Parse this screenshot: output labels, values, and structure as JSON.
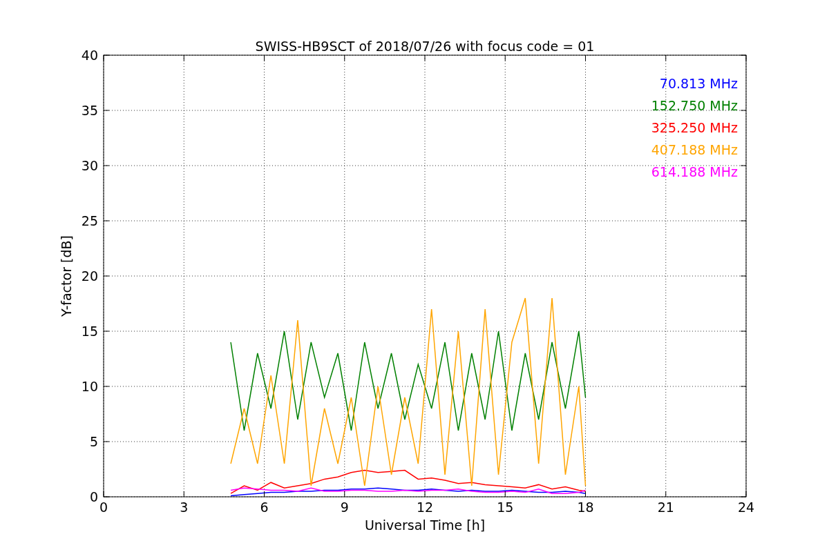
{
  "chart_data": {
    "type": "line",
    "title": "SWISS-HB9SCT of 2018/07/26 with focus code = 01",
    "xlabel": "Universal Time [h]",
    "ylabel": "Y-factor [dB]",
    "xlim": [
      0,
      24
    ],
    "ylim": [
      0,
      40
    ],
    "xticks": [
      0,
      3,
      6,
      9,
      12,
      15,
      18,
      21,
      24
    ],
    "yticks": [
      0,
      5,
      10,
      15,
      20,
      25,
      30,
      35,
      40
    ],
    "grid": true,
    "x": [
      4.75,
      5.25,
      5.75,
      6.25,
      6.75,
      7.25,
      7.75,
      8.25,
      8.75,
      9.25,
      9.75,
      10.25,
      10.75,
      11.25,
      11.75,
      12.25,
      12.75,
      13.25,
      13.75,
      14.25,
      14.75,
      15.25,
      15.75,
      16.25,
      16.75,
      17.25,
      17.75,
      18
    ],
    "series": [
      {
        "name": "70.813 MHz",
        "color": "#0000ff",
        "values": [
          0.1,
          0.2,
          0.3,
          0.4,
          0.4,
          0.5,
          0.5,
          0.6,
          0.6,
          0.7,
          0.7,
          0.8,
          0.7,
          0.6,
          0.6,
          0.7,
          0.6,
          0.5,
          0.6,
          0.5,
          0.5,
          0.6,
          0.5,
          0.4,
          0.4,
          0.5,
          0.4,
          0.3
        ]
      },
      {
        "name": "152.750 MHz",
        "color": "#008000",
        "values": [
          14,
          6,
          13,
          8,
          15,
          7,
          14,
          9,
          13,
          6,
          14,
          8,
          13,
          7,
          12,
          8,
          14,
          6,
          13,
          7,
          15,
          6,
          13,
          7,
          14,
          8,
          15,
          9
        ]
      },
      {
        "name": "325.250 MHz",
        "color": "#ff0000",
        "values": [
          0.3,
          1,
          0.6,
          1.3,
          0.8,
          1,
          1.2,
          1.6,
          1.8,
          2.2,
          2.4,
          2.2,
          2.3,
          2.4,
          1.6,
          1.7,
          1.5,
          1.2,
          1.3,
          1.1,
          1,
          0.9,
          0.8,
          1.1,
          0.7,
          0.9,
          0.6,
          0.5
        ]
      },
      {
        "name": "407.188 MHz",
        "color": "#ffa500",
        "values": [
          3,
          8,
          3,
          11,
          3,
          16,
          1,
          8,
          3,
          9,
          1,
          10,
          2,
          9,
          3,
          17,
          2,
          15,
          1,
          17,
          2,
          14,
          18,
          3,
          18,
          2,
          10,
          1
        ]
      },
      {
        "name": "614.188 MHz",
        "color": "#ff00ff",
        "values": [
          0.6,
          0.8,
          0.7,
          0.6,
          0.6,
          0.5,
          0.8,
          0.5,
          0.5,
          0.6,
          0.6,
          0.5,
          0.5,
          0.6,
          0.5,
          0.6,
          0.6,
          0.7,
          0.5,
          0.4,
          0.4,
          0.5,
          0.4,
          0.7,
          0.3,
          0.3,
          0.4,
          0.6
        ]
      }
    ]
  }
}
